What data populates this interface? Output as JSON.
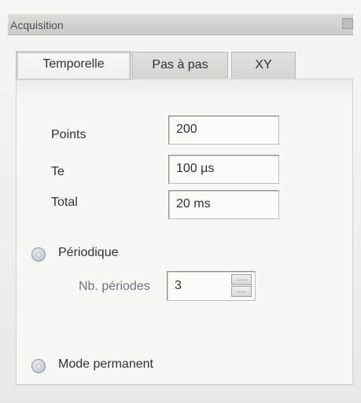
{
  "window": {
    "title": "Acquisition"
  },
  "tabs": [
    {
      "label": "Temporelle",
      "active": true
    },
    {
      "label": "Pas à pas",
      "active": false
    },
    {
      "label": "XY",
      "active": false
    }
  ],
  "fields": {
    "points": {
      "label": "Points",
      "value": "200"
    },
    "te": {
      "label": "Te",
      "value": "100 µs"
    },
    "total": {
      "label": "Total",
      "value": "20 ms"
    }
  },
  "periodique": {
    "label": "Périodique",
    "selected": false,
    "nb_periodes_label": "Nb. périodes",
    "nb_periodes_value": "3"
  },
  "mode_permanent": {
    "label": "Mode permanent",
    "selected": false
  }
}
